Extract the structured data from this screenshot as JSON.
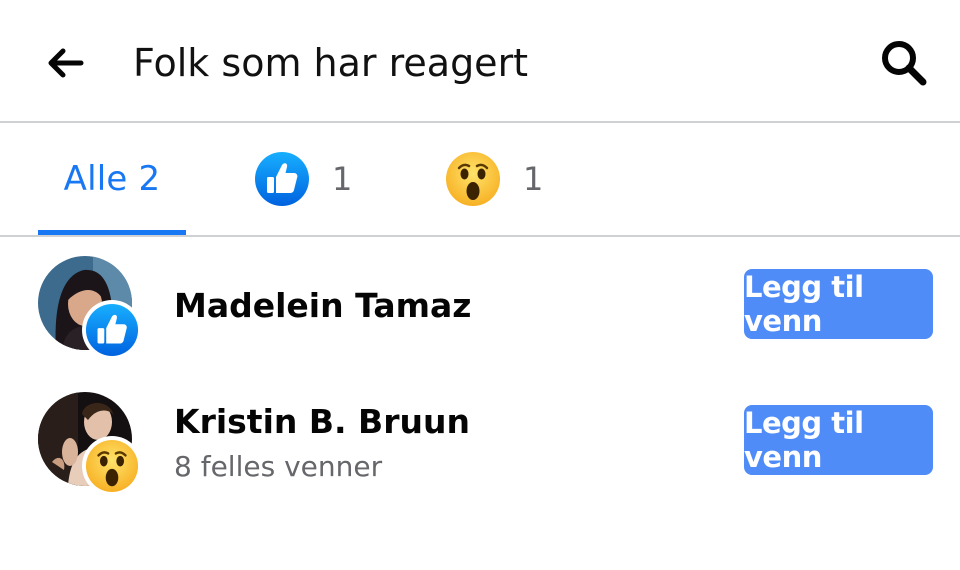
{
  "header": {
    "title": "Folk som har reagert",
    "back_icon": "arrow-left-icon",
    "search_icon": "search-icon"
  },
  "tabs": [
    {
      "label": "Alle 2",
      "selected": true
    },
    {
      "icon": "like-reaction-icon",
      "count": "1"
    },
    {
      "icon": "wow-reaction-icon",
      "count": "1"
    }
  ],
  "people": [
    {
      "name": "Madelein Tamaz",
      "subtitle": "",
      "reaction": "like-reaction-icon",
      "button": "Legg til venn"
    },
    {
      "name": "Kristin B. Bruun",
      "subtitle": "8 felles venner",
      "reaction": "wow-reaction-icon",
      "button": "Legg til venn"
    }
  ],
  "colors": {
    "accent": "#1877f2",
    "button_bg": "#4f8cf7",
    "divider": "#cfd1d5",
    "secondary_text": "#65676b"
  }
}
